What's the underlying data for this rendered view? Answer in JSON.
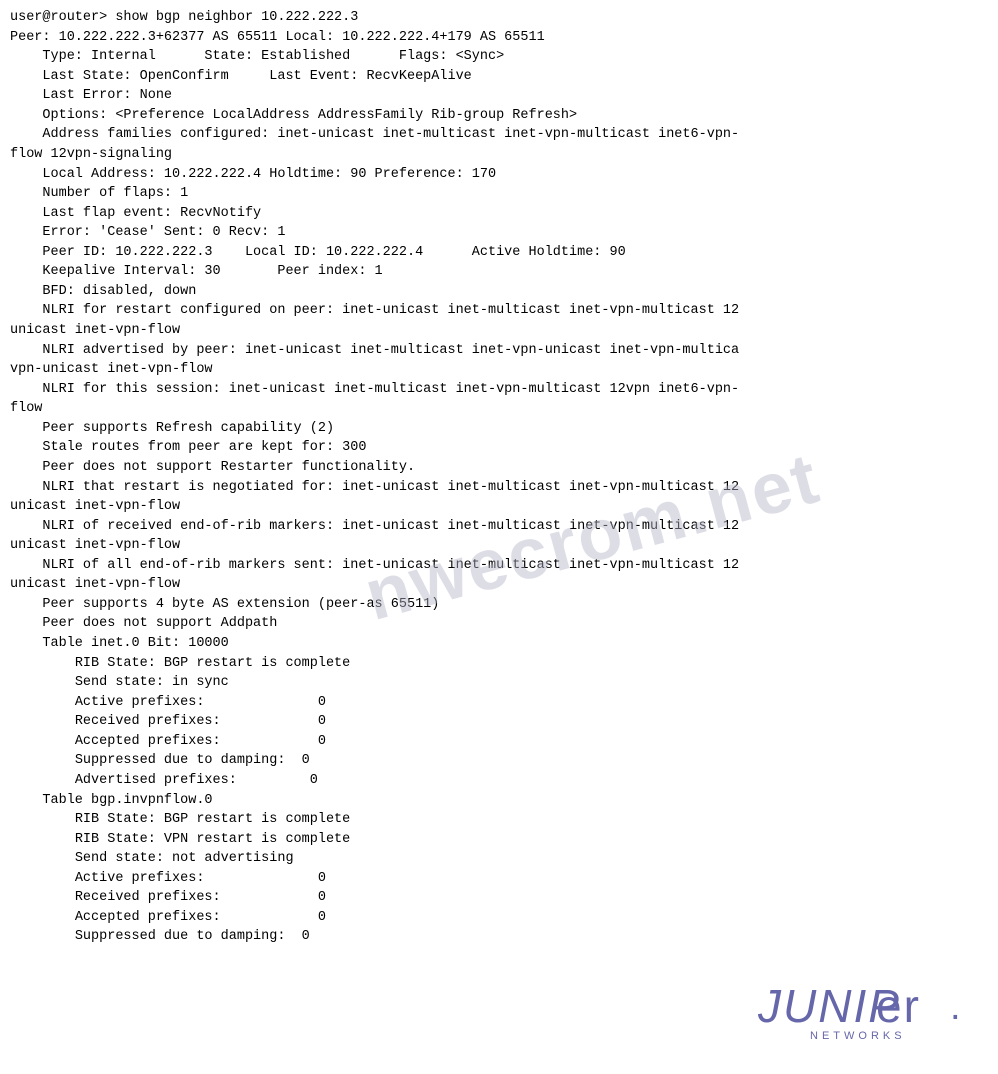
{
  "terminal": {
    "lines": [
      "user@router> show bgp neighbor 10.222.222.3",
      "Peer: 10.222.222.3+62377 AS 65511 Local: 10.222.222.4+179 AS 65511",
      "    Type: Internal      State: Established      Flags: <Sync>",
      "    Last State: OpenConfirm     Last Event: RecvKeepAlive",
      "    Last Error: None",
      "    Options: <Preference LocalAddress AddressFamily Rib-group Refresh>",
      "    Address families configured: inet-unicast inet-multicast inet-vpn-multicast inet6-vpn-",
      "flow 12vpn-signaling",
      "    Local Address: 10.222.222.4 Holdtime: 90 Preference: 170",
      "    Number of flaps: 1",
      "    Last flap event: RecvNotify",
      "    Error: 'Cease' Sent: 0 Recv: 1",
      "    Peer ID: 10.222.222.3    Local ID: 10.222.222.4      Active Holdtime: 90",
      "    Keepalive Interval: 30       Peer index: 1",
      "    BFD: disabled, down",
      "    NLRI for restart configured on peer: inet-unicast inet-multicast inet-vpn-multicast 12",
      "unicast inet-vpn-flow",
      "    NLRI advertised by peer: inet-unicast inet-multicast inet-vpn-unicast inet-vpn-multica",
      "vpn-unicast inet-vpn-flow",
      "    NLRI for this session: inet-unicast inet-multicast inet-vpn-multicast 12vpn inet6-vpn-",
      "flow",
      "    Peer supports Refresh capability (2)",
      "    Stale routes from peer are kept for: 300",
      "    Peer does not support Restarter functionality.",
      "    NLRI that restart is negotiated for: inet-unicast inet-multicast inet-vpn-multicast 12",
      "unicast inet-vpn-flow",
      "    NLRI of received end-of-rib markers: inet-unicast inet-multicast inet-vpn-multicast 12",
      "unicast inet-vpn-flow",
      "    NLRI of all end-of-rib markers sent: inet-unicast inet-multicast inet-vpn-multicast 12",
      "unicast inet-vpn-flow",
      "    Peer supports 4 byte AS extension (peer-as 65511)",
      "    Peer does not support Addpath",
      "    Table inet.0 Bit: 10000",
      "        RIB State: BGP restart is complete",
      "        Send state: in sync",
      "        Active prefixes:              0",
      "        Received prefixes:            0",
      "        Accepted prefixes:            0",
      "        Suppressed due to damping:  0",
      "        Advertised prefixes:         0",
      "    Table bgp.invpnflow.0",
      "        RIB State: BGP restart is complete",
      "        RIB State: VPN restart is complete",
      "        Send state: not advertising",
      "        Active prefixes:              0",
      "        Received prefixes:            0",
      "        Accepted prefixes:            0",
      "        Suppressed due to damping:  0"
    ]
  },
  "watermark": {
    "text": "nwecrom.net"
  },
  "logo": {
    "brand": "JUNIPer.",
    "networks": "NETWORKS"
  }
}
